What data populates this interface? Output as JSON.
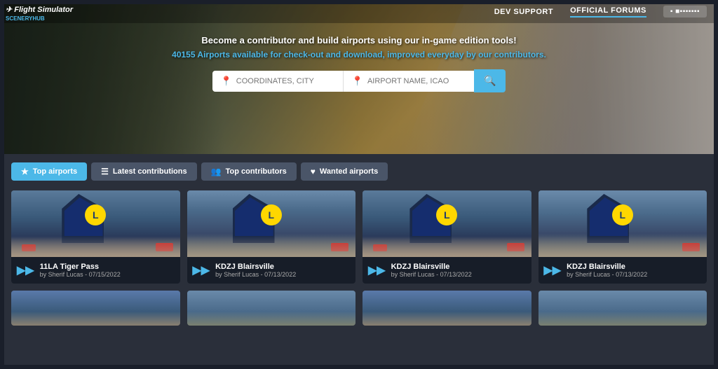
{
  "nav": {
    "dev_support": "DEV SUPPORT",
    "official_forums": "OFFICIAL FORUMS",
    "user_placeholder": "▪ ■▪▪▪▪▪▪▪"
  },
  "header": {
    "tagline": "Become a contributor and build airports using our in-game edition tools!",
    "count_text": "40155 Airports",
    "count_suffix": " available for check-out and download, improved everyday by our contributors.",
    "search_coords_placeholder": "COORDINATES, CITY",
    "search_airport_placeholder": "AIRPORT NAME, ICAO"
  },
  "tabs": [
    {
      "id": "top-airports",
      "label": "Top airports",
      "icon": "★",
      "active": true
    },
    {
      "id": "latest-contributions",
      "label": "Latest contributions",
      "icon": "☰",
      "active": false
    },
    {
      "id": "top-contributors",
      "label": "Top contributors",
      "icon": "👥",
      "active": false
    },
    {
      "id": "wanted-airports",
      "label": "Wanted airports",
      "icon": "♥",
      "active": false
    }
  ],
  "airports": [
    {
      "id": "11la",
      "code": "11LA",
      "name": "Tiger Pass",
      "author": "Sherif Lucas",
      "date": "07/15/2022"
    },
    {
      "id": "kdzj1",
      "code": "KDZJ",
      "name": "Blairsville",
      "author": "Sherif Lucas",
      "date": "07/13/2022"
    },
    {
      "id": "kdzj2",
      "code": "KDZJ",
      "name": "Blairsville",
      "author": "Sherif Lucas",
      "date": "07/13/2022"
    },
    {
      "id": "kdzj3",
      "code": "KDZJ",
      "name": "Blairsville",
      "author": "Sherif Lucas",
      "date": "07/13/2022"
    }
  ],
  "card_label_by": "by"
}
